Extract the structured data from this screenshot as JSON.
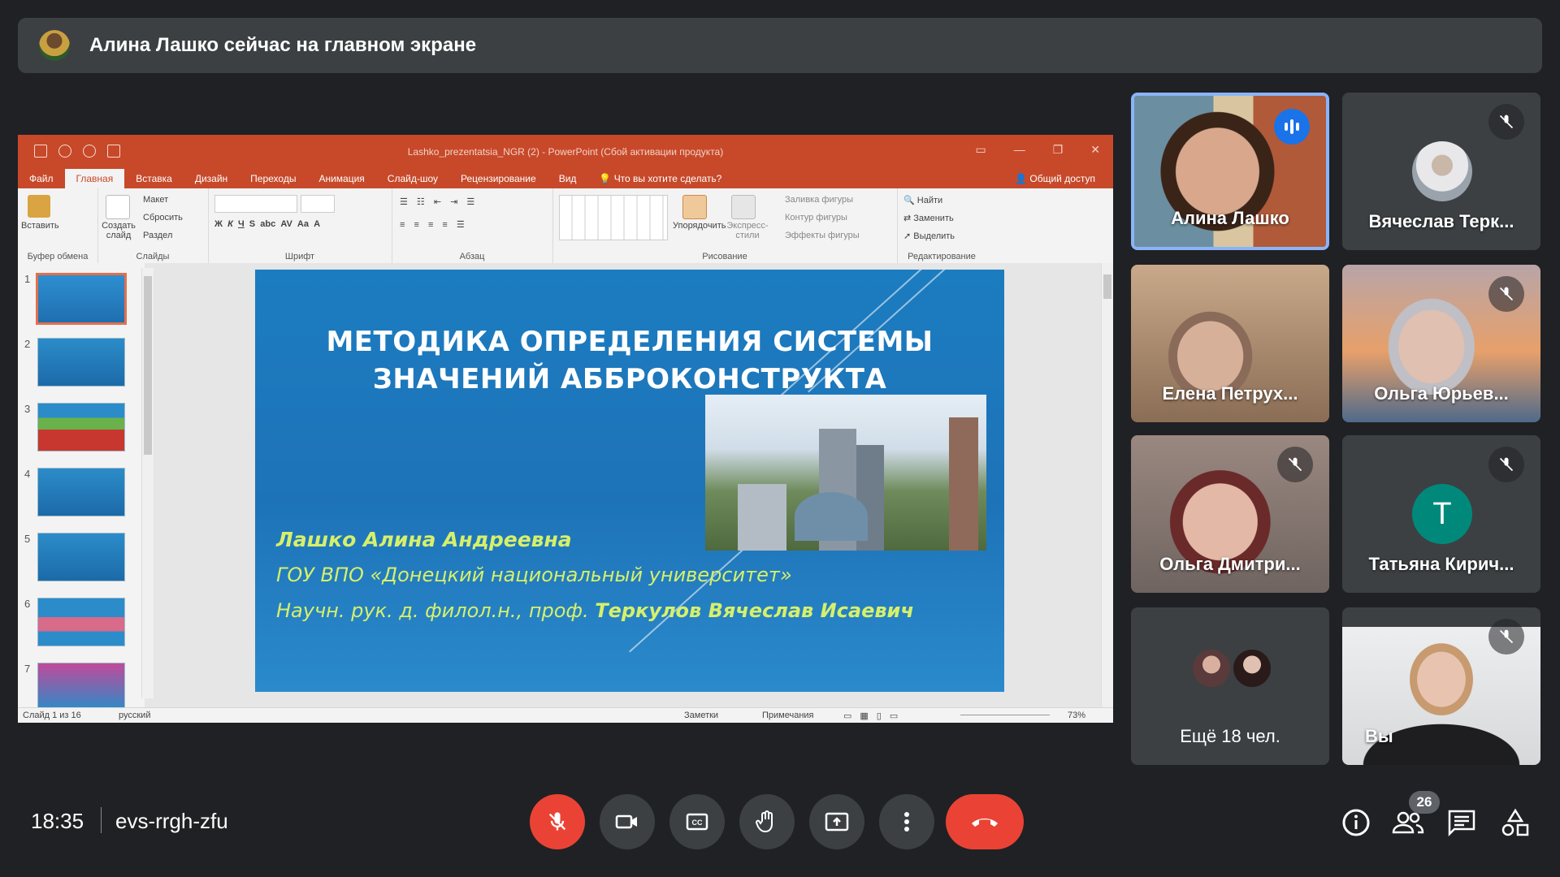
{
  "banner": {
    "text": "Алина Лашко сейчас на главном экране"
  },
  "ppt": {
    "doc_title": "Lashko_prezentatsia_NGR (2) - PowerPoint (Сбой активации продукта)",
    "tabs": [
      "Файл",
      "Главная",
      "Вставка",
      "Дизайн",
      "Переходы",
      "Анимация",
      "Слайд-шоу",
      "Рецензирование",
      "Вид",
      "Что вы хотите сделать?"
    ],
    "share": "Общий доступ",
    "ribbon": {
      "paste": "Вставить",
      "new_slide": "Создать слайд",
      "layout": "Макет",
      "reset": "Сбросить",
      "section": "Раздел",
      "arrange": "Упорядочить",
      "quick_styles": "Экспресс-стили",
      "fill": "Заливка фигуры",
      "outline": "Контур фигуры",
      "effects": "Эффекты фигуры",
      "find": "Найти",
      "replace": "Заменить",
      "select": "Выделить",
      "groups": [
        "Буфер обмена",
        "Слайды",
        "Шрифт",
        "Абзац",
        "Рисование",
        "Редактирование"
      ]
    },
    "thumb_numbers": [
      "1",
      "2",
      "3",
      "4",
      "5",
      "6",
      "7"
    ],
    "slide": {
      "title_line1": "МЕТОДИКА ОПРЕДЕЛЕНИЯ СИСТЕМЫ",
      "title_line2": "ЗНАЧЕНИЙ АББРОКОНСТРУКТА",
      "author": "Лашко Алина Андреевна",
      "org": "ГОУ ВПО «Донецкий национальный университет»",
      "sup_prefix": "Научн. рук. д. филол.н., проф. ",
      "sup_name": "Теркулов Вячеслав Исаевич"
    },
    "status": {
      "slide_counter": "Слайд 1 из 16",
      "language": "русский",
      "notes": "Заметки",
      "comments": "Примечания",
      "zoom": "73%"
    }
  },
  "participants": [
    {
      "name": "Алина Лашко",
      "state": "speaking"
    },
    {
      "name": "Вячеслав Терк...",
      "state": "muted"
    },
    {
      "name": "Елена Петрух...",
      "state": "unmuted"
    },
    {
      "name": "Ольга Юрьев...",
      "state": "muted"
    },
    {
      "name": "Ольга Дмитри...",
      "state": "muted"
    },
    {
      "name": "Татьяна Кирич...",
      "state": "muted",
      "initial": "T"
    },
    {
      "name": "Ещё 18 чел."
    },
    {
      "name": "Вы",
      "state": "muted"
    }
  ],
  "footer": {
    "time": "18:35",
    "meeting_code": "evs-rrgh-zfu",
    "participant_count": "26"
  },
  "colors": {
    "bg": "#202124",
    "tile": "#3c4043",
    "danger": "#ea4335",
    "speaking": "#1a73e8",
    "ppt_accent": "#c7492a"
  }
}
